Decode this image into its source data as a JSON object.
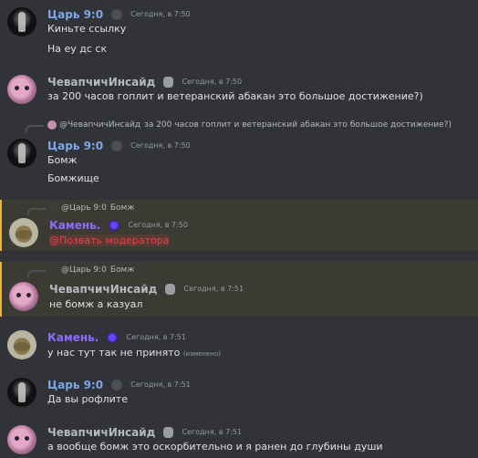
{
  "messages": [
    {
      "author": "Царь 9:0",
      "time": "Сегодня, в 7:50",
      "lines": [
        "Киньте ссылку",
        "На еу дс ск"
      ]
    },
    {
      "author": "ЧевапчичИнсайд",
      "time": "Сегодня, в 7:50",
      "lines": [
        "за 200 часов гоплит и ветеранский абакан это большое достижение?)"
      ]
    },
    {
      "reply_author": "@ЧевапчичИнсайд",
      "reply_text": "за 200 часов гоплит и ветеранский абакан это большое достижение?)",
      "author": "Царь 9:0",
      "time": "Сегодня, в 7:50",
      "lines": [
        "Бомж",
        "Бомжище"
      ]
    },
    {
      "reply_author": "@Царь 9:0",
      "reply_text": "Бомж",
      "author": "Камень.",
      "time": "Сегодня, в 7:50",
      "lines": [
        "@Позвать модератора"
      ]
    },
    {
      "reply_author": "@Царь 9:0",
      "reply_text": "Бомж",
      "author": "ЧевапчичИнсайд",
      "time": "Сегодня, в 7:51",
      "lines": [
        "не бомж а казуал"
      ]
    },
    {
      "author": "Камень.",
      "time": "Сегодня, в 7:51",
      "lines": [
        "у нас тут так не принято"
      ],
      "edited": "(изменено)"
    },
    {
      "author": "Царь 9:0",
      "time": "Сегодня, в 7:51",
      "lines": [
        "Да вы рофлите"
      ]
    },
    {
      "author": "ЧевапчичИнсайд",
      "time": "Сегодня, в 7:51",
      "lines": [
        "а вообще бомж это оскорбительно и я ранен до глубины души"
      ]
    }
  ],
  "colors": {
    "background": "#313338",
    "highlight": "#3b3a33",
    "highlight_border": "#f0b232",
    "name_tsar": "#7da6e8",
    "name_cheb": "#b5bac1",
    "name_stone": "#8e6bff",
    "mention": "#f23f43"
  },
  "icons": {
    "tsar_badge": "spider-icon",
    "cheb_badge": "skull-icon",
    "stone_badge": "orb-icon"
  }
}
